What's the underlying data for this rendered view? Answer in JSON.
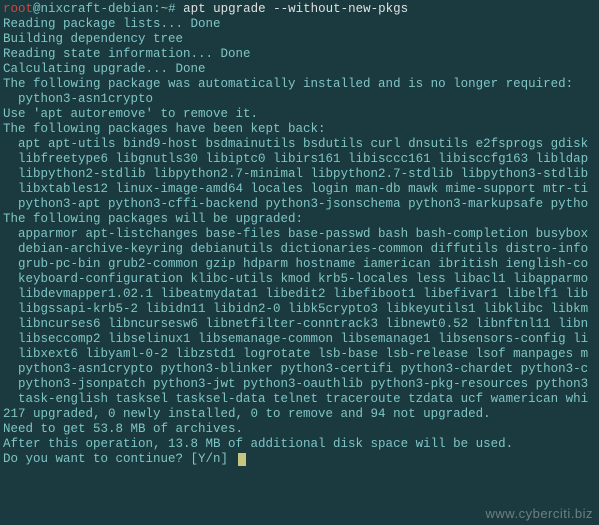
{
  "prompt": {
    "user": "root",
    "at": "@",
    "host": "nixcraft-debian",
    "colon": ":",
    "path": "~",
    "hash": "# "
  },
  "command": "apt upgrade --without-new-pkgs",
  "lines": {
    "l1": "Reading package lists... Done",
    "l2": "Building dependency tree",
    "l3": "Reading state information... Done",
    "l4": "Calculating upgrade... Done",
    "l5": "The following package was automatically installed and is no longer required:",
    "l6": "  python3-asn1crypto",
    "l7": "Use 'apt autoremove' to remove it.",
    "l8": "The following packages have been kept back:",
    "l9": "  apt apt-utils bind9-host bsdmainutils bsdutils curl dnsutils e2fsprogs gdisk",
    "l10": "  libfreetype6 libgnutls30 libiptc0 libirs161 libisccc161 libisccfg163 libldap",
    "l11": "  libpython2-stdlib libpython2.7-minimal libpython2.7-stdlib libpython3-stdlib",
    "l12": "  libxtables12 linux-image-amd64 locales login man-db mawk mime-support mtr-ti",
    "l13": "  python3-apt python3-cffi-backend python3-jsonschema python3-markupsafe pytho",
    "l14": "The following packages will be upgraded:",
    "l15": "  apparmor apt-listchanges base-files base-passwd bash bash-completion busybox",
    "l16": "  debian-archive-keyring debianutils dictionaries-common diffutils distro-info",
    "l17": "  grub-pc-bin grub2-common gzip hdparm hostname iamerican ibritish ienglish-co",
    "l18": "  keyboard-configuration klibc-utils kmod krb5-locales less libacl1 libapparmo",
    "l19": "  libdevmapper1.02.1 libeatmydata1 libedit2 libefiboot1 libefivar1 libelf1 lib",
    "l20": "  libgssapi-krb5-2 libidn11 libidn2-0 libk5crypto3 libkeyutils1 libklibc libkm",
    "l21": "  libncurses6 libncursesw6 libnetfilter-conntrack3 libnewt0.52 libnftnl11 libn",
    "l22": "  libseccomp2 libselinux1 libsemanage-common libsemanage1 libsensors-config li",
    "l23": "  libxext6 libyaml-0-2 libzstd1 logrotate lsb-base lsb-release lsof manpages m",
    "l24": "  python3-asn1crypto python3-blinker python3-certifi python3-chardet python3-c",
    "l25": "  python3-jsonpatch python3-jwt python3-oauthlib python3-pkg-resources python3",
    "l26": "  task-english tasksel tasksel-data telnet traceroute tzdata ucf wamerican whi",
    "l27": "217 upgraded, 0 newly installed, 0 to remove and 94 not upgraded.",
    "l28": "Need to get 53.8 MB of archives.",
    "l29": "After this operation, 13.8 MB of additional disk space will be used.",
    "l30": "Do you want to continue? [Y/n] "
  },
  "watermark": "www.cyberciti.biz"
}
